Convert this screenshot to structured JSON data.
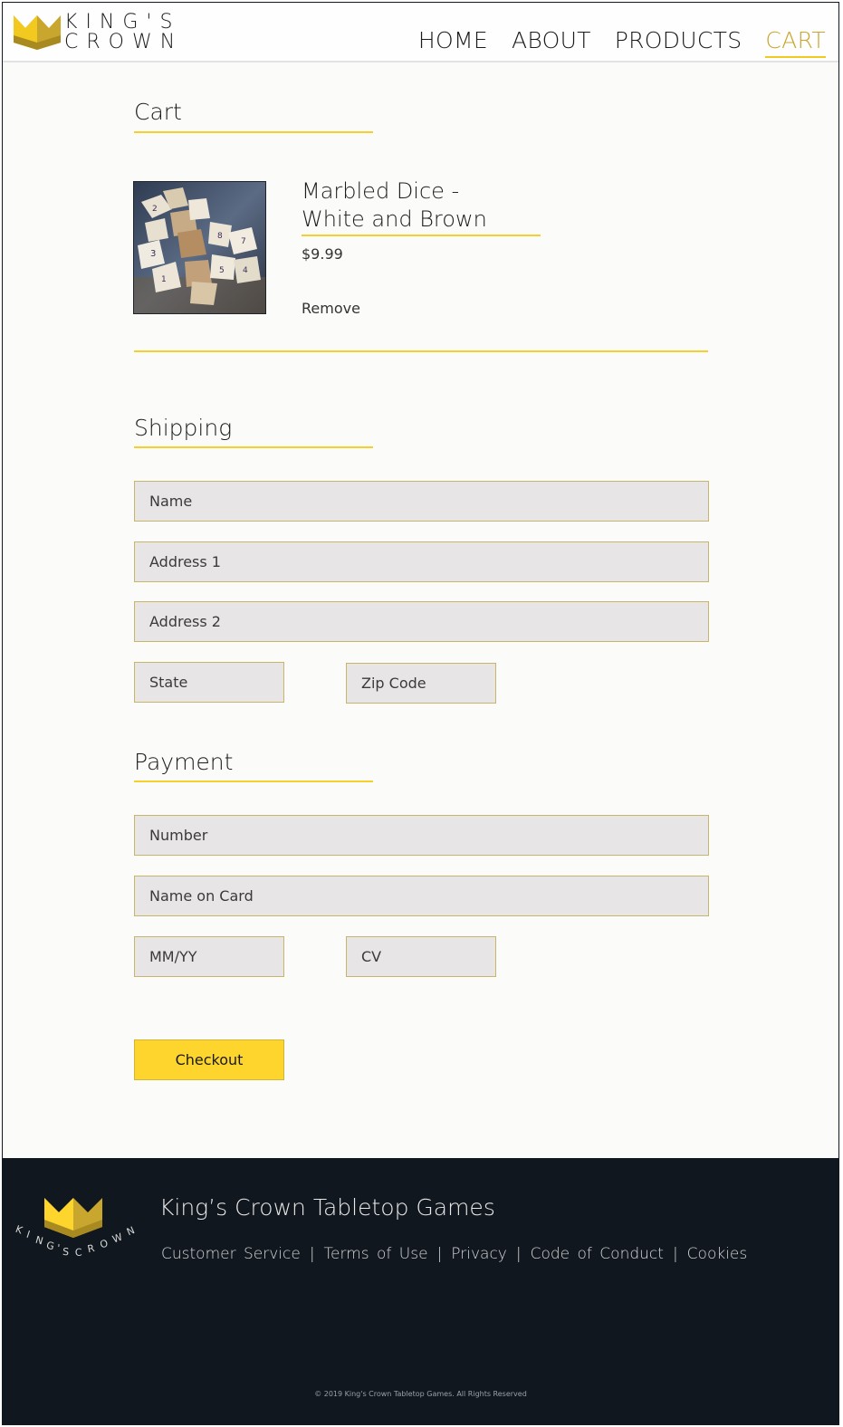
{
  "brand": {
    "line1": "KING'S",
    "line2": "CROWN",
    "footer_ring_text": "KING'S CROWN"
  },
  "nav": {
    "items": [
      {
        "label": "HOME",
        "active": false
      },
      {
        "label": "ABOUT",
        "active": false
      },
      {
        "label": "PRODUCTS",
        "active": false
      },
      {
        "label": "CART",
        "active": true
      }
    ]
  },
  "cart": {
    "title": "Cart",
    "items": [
      {
        "name_line1": "Marbled Dice -",
        "name_line2": "White and Brown",
        "price": "$9.99",
        "remove_label": "Remove",
        "image": "marbled-dice-photo"
      }
    ]
  },
  "shipping": {
    "title": "Shipping",
    "name_placeholder": "Name",
    "address1_placeholder": "Address 1",
    "address2_placeholder": "Address 2",
    "state_placeholder": "State",
    "zip_placeholder": "Zip Code"
  },
  "payment": {
    "title": "Payment",
    "number_placeholder": "Number",
    "name_on_card_placeholder": "Name on Card",
    "expiry_placeholder": "MM/YY",
    "cv_placeholder": "CV"
  },
  "checkout_label": "Checkout",
  "footer": {
    "title": "King’s Crown Tabletop Games",
    "links": [
      "Customer Service",
      "Terms of Use",
      "Privacy",
      "Code of Conduct",
      "Cookies"
    ],
    "copyright": "© 2019 King's Crown Tabletop Games. All Rights Reserved"
  },
  "colors": {
    "accent_yellow": "#f6cf2a",
    "active_nav": "#c9a62d",
    "footer_bg": "#11171e",
    "field_bg": "#e8e5e7"
  }
}
